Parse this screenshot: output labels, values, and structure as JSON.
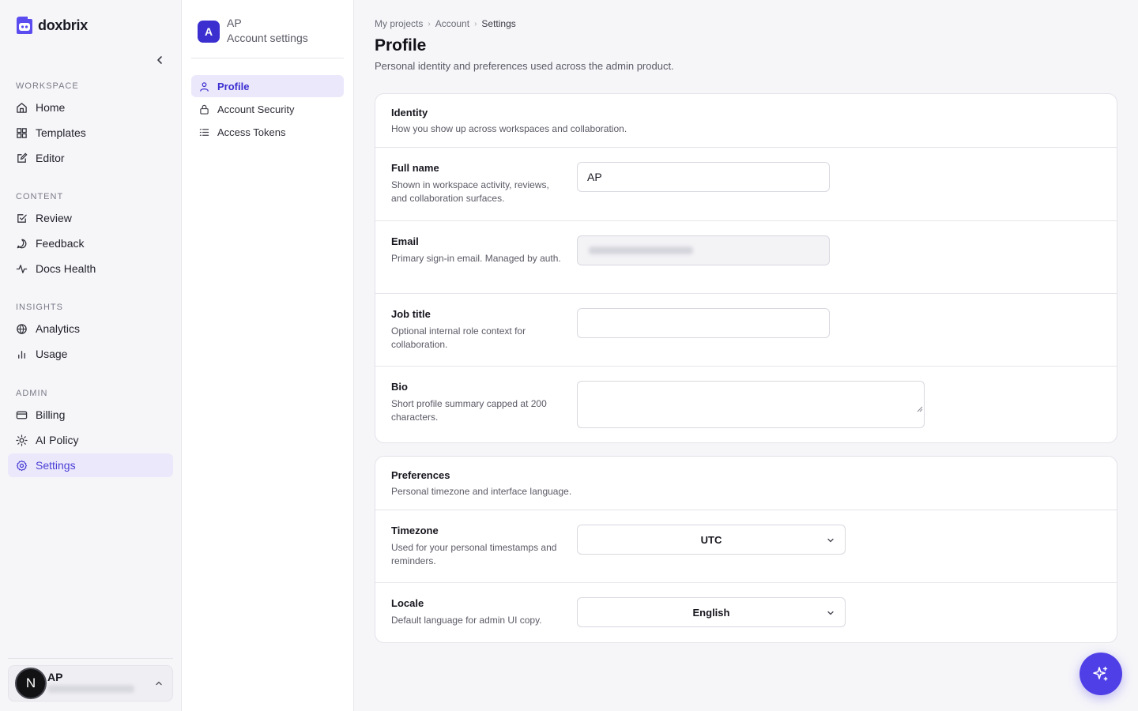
{
  "brand": {
    "name": "doxbrix",
    "accent": "#4f3fe6"
  },
  "sidebar": {
    "sections": [
      {
        "heading": "WORKSPACE",
        "items": [
          {
            "label": "Home",
            "icon": "home-icon"
          },
          {
            "label": "Templates",
            "icon": "grid-icon"
          },
          {
            "label": "Editor",
            "icon": "edit-icon"
          }
        ]
      },
      {
        "heading": "CONTENT",
        "items": [
          {
            "label": "Review",
            "icon": "check-square-icon"
          },
          {
            "label": "Feedback",
            "icon": "message-icon"
          },
          {
            "label": "Docs Health",
            "icon": "activity-icon"
          }
        ]
      },
      {
        "heading": "INSIGHTS",
        "items": [
          {
            "label": "Analytics",
            "icon": "globe-icon"
          },
          {
            "label": "Usage",
            "icon": "bar-chart-icon"
          }
        ]
      },
      {
        "heading": "ADMIN",
        "items": [
          {
            "label": "Billing",
            "icon": "credit-card-icon"
          },
          {
            "label": "AI Policy",
            "icon": "sun-icon"
          },
          {
            "label": "Settings",
            "icon": "gear-icon",
            "active": true
          }
        ]
      }
    ],
    "user": {
      "initial": "N",
      "name": "AP"
    }
  },
  "account": {
    "initial": "A",
    "name": "AP",
    "subtitle": "Account settings",
    "nav": [
      {
        "label": "Profile",
        "icon": "user-icon",
        "active": true
      },
      {
        "label": "Account Security",
        "icon": "lock-icon"
      },
      {
        "label": "Access Tokens",
        "icon": "list-icon"
      }
    ]
  },
  "breadcrumb": [
    "My projects",
    "Account",
    "Settings"
  ],
  "page": {
    "title": "Profile",
    "subtitle": "Personal identity and preferences used across the admin product."
  },
  "identity": {
    "title": "Identity",
    "description": "How you show up across workspaces and collaboration.",
    "full_name": {
      "label": "Full name",
      "description": "Shown in workspace activity, reviews, and collaboration surfaces.",
      "value": "AP"
    },
    "email": {
      "label": "Email",
      "description": "Primary sign-in email. Managed by auth."
    },
    "job_title": {
      "label": "Job title",
      "description": "Optional internal role context for collaboration.",
      "value": ""
    },
    "bio": {
      "label": "Bio",
      "description": "Short profile summary capped at 200 characters.",
      "value": ""
    }
  },
  "preferences": {
    "title": "Preferences",
    "description": "Personal timezone and interface language.",
    "timezone": {
      "label": "Timezone",
      "description": "Used for your personal timestamps and reminders.",
      "value": "UTC"
    },
    "locale": {
      "label": "Locale",
      "description": "Default language for admin UI copy.",
      "value": "English"
    }
  },
  "fab": {
    "icon": "sparkle-icon"
  }
}
